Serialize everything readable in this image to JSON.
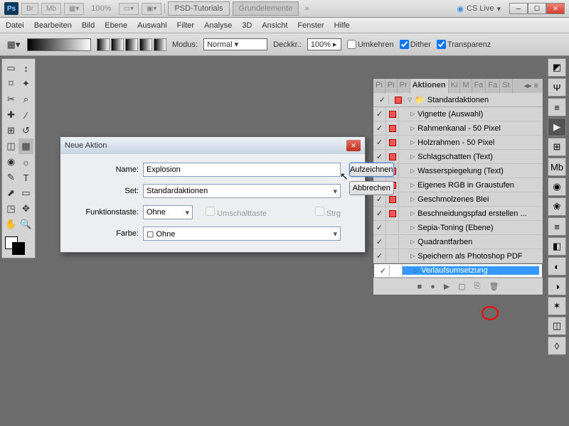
{
  "topbar": {
    "zoom": "100%",
    "tabs": [
      "PSD-Tutorials",
      "Grundelemente"
    ],
    "cslive": "CS Live"
  },
  "menu": [
    "Datei",
    "Bearbeiten",
    "Bild",
    "Ebene",
    "Auswahl",
    "Filter",
    "Analyse",
    "3D",
    "Ansicht",
    "Fenster",
    "Hilfe"
  ],
  "optbar": {
    "modus_label": "Modus:",
    "modus_value": "Normal",
    "deck_label": "Deckkr.:",
    "deck_value": "100%",
    "umkehren": "Umkehren",
    "dither": "Dither",
    "transparenz": "Transparenz"
  },
  "actions_panel": {
    "tabs": [
      "Pi",
      "Pi",
      "Pr",
      "Aktionen",
      "Ki",
      "M",
      "Fa",
      "Fa",
      "St"
    ],
    "folder": "Standardaktionen",
    "items": [
      "Vignette (Auswahl)",
      "Rahmenkanal - 50 Pixel",
      "Holzrahmen - 50 Pixel",
      "Schlagschatten (Text)",
      "Wasserspiegelung (Text)",
      "Eigenes RGB in Graustufen",
      "Geschmolzenes Blei",
      "Beschneidungspfad erstellen ...",
      "Sepia-Toning (Ebene)",
      "Quadrantfarben",
      "Speichern als Photoshop PDF",
      "Verlaufsumsetzung"
    ],
    "selected": 11
  },
  "dialog": {
    "title": "Neue Aktion",
    "name_label": "Name:",
    "name_value": "Explosion",
    "set_label": "Set:",
    "set_value": "Standardaktionen",
    "fkey_label": "Funktionstaste:",
    "fkey_value": "Ohne",
    "shift": "Umschalttaste",
    "ctrl": "Strg",
    "color_label": "Farbe:",
    "color_value": "Ohne",
    "record": "Aufzeichnen",
    "cancel": "Abbrechen"
  }
}
